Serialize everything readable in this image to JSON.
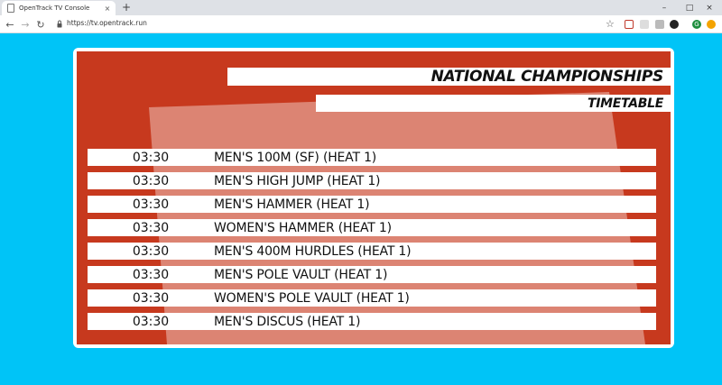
{
  "browser": {
    "tab_title": "OpenTrack TV Console",
    "tab_close": "×",
    "new_tab": "+",
    "window_controls": [
      "–",
      "□",
      "×"
    ],
    "url": "https://tv.opentrack.run",
    "nav": {
      "back": "←",
      "forward": "→",
      "reload": "↻"
    },
    "star": "☆",
    "profile_initial": "G"
  },
  "board": {
    "title": "NATIONAL CHAMPIONSHIPS",
    "subtitle": "TIMETABLE",
    "accent_color": "#c7391e",
    "background_color": "#00c4f7",
    "events": [
      {
        "time": "03:30",
        "event": "MEN'S 100M (SF) (HEAT 1)"
      },
      {
        "time": "03:30",
        "event": "MEN'S HIGH JUMP (HEAT 1)"
      },
      {
        "time": "03:30",
        "event": "MEN'S HAMMER (HEAT 1)"
      },
      {
        "time": "03:30",
        "event": "WOMEN'S HAMMER (HEAT 1)"
      },
      {
        "time": "03:30",
        "event": "MEN'S 400M HURDLES (HEAT 1)"
      },
      {
        "time": "03:30",
        "event": "MEN'S POLE VAULT (HEAT 1)"
      },
      {
        "time": "03:30",
        "event": "WOMEN'S POLE VAULT (HEAT 1)"
      },
      {
        "time": "03:30",
        "event": "MEN'S DISCUS (HEAT 1)"
      }
    ]
  }
}
